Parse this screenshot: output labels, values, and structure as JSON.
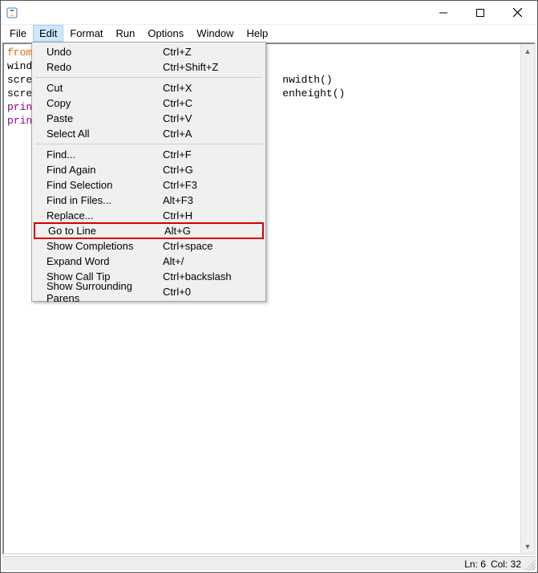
{
  "menubar": [
    "File",
    "Edit",
    "Format",
    "Run",
    "Options",
    "Window",
    "Help"
  ],
  "menubar_open_index": 1,
  "code_lines": [
    {
      "tokens": [
        {
          "t": "from",
          "cls": "kw"
        }
      ]
    },
    {
      "tokens": [
        {
          "t": "wind",
          "cls": ""
        }
      ]
    },
    {
      "tokens": [
        {
          "t": "scre",
          "cls": ""
        }
      ],
      "tail": "nwidth()"
    },
    {
      "tokens": [
        {
          "t": "scre",
          "cls": ""
        }
      ],
      "tail": "enheight()"
    },
    {
      "tokens": [
        {
          "t": "prin",
          "cls": "builtin"
        }
      ]
    },
    {
      "tokens": [
        {
          "t": "prin",
          "cls": "builtin"
        }
      ]
    }
  ],
  "dropdown": {
    "groups": [
      [
        {
          "label": "Undo",
          "shortcut": "Ctrl+Z"
        },
        {
          "label": "Redo",
          "shortcut": "Ctrl+Shift+Z"
        }
      ],
      [
        {
          "label": "Cut",
          "shortcut": "Ctrl+X"
        },
        {
          "label": "Copy",
          "shortcut": "Ctrl+C"
        },
        {
          "label": "Paste",
          "shortcut": "Ctrl+V"
        },
        {
          "label": "Select All",
          "shortcut": "Ctrl+A"
        }
      ],
      [
        {
          "label": "Find...",
          "shortcut": "Ctrl+F"
        },
        {
          "label": "Find Again",
          "shortcut": "Ctrl+G"
        },
        {
          "label": "Find Selection",
          "shortcut": "Ctrl+F3"
        },
        {
          "label": "Find in Files...",
          "shortcut": "Alt+F3"
        },
        {
          "label": "Replace...",
          "shortcut": "Ctrl+H"
        },
        {
          "label": "Go to Line",
          "shortcut": "Alt+G",
          "highlight": true
        },
        {
          "label": "Show Completions",
          "shortcut": "Ctrl+space"
        },
        {
          "label": "Expand Word",
          "shortcut": "Alt+/"
        },
        {
          "label": "Show Call Tip",
          "shortcut": "Ctrl+backslash"
        },
        {
          "label": "Show Surrounding Parens",
          "shortcut": "Ctrl+0"
        }
      ]
    ]
  },
  "status": {
    "ln_label": "Ln:",
    "ln": "6",
    "col_label": "Col:",
    "col": "32"
  }
}
